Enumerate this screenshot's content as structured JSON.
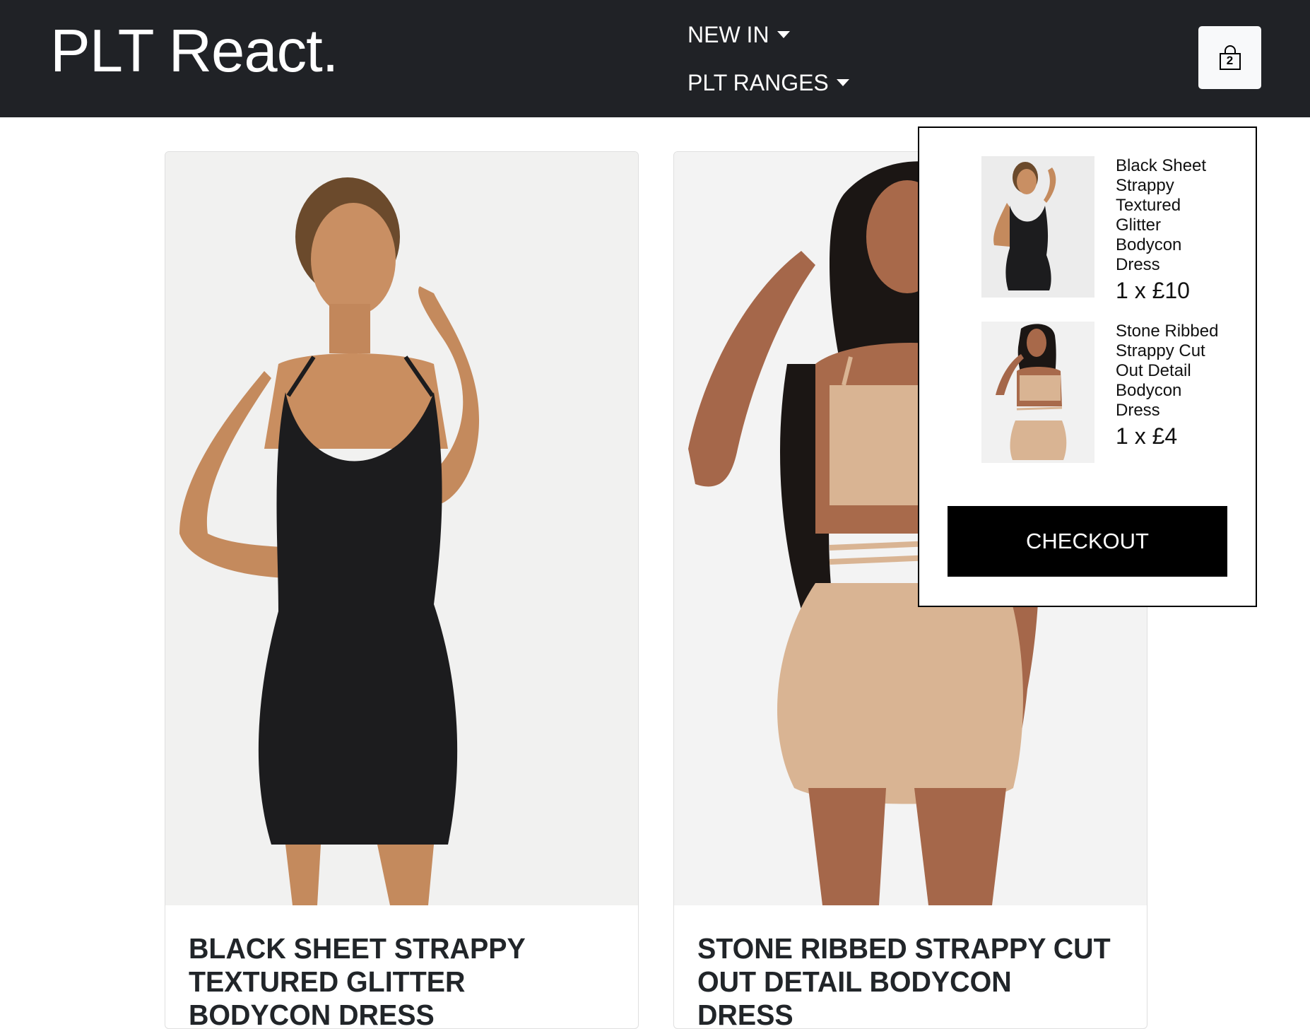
{
  "header": {
    "brand": "PLT React.",
    "nav": [
      {
        "label": "NEW IN"
      },
      {
        "label": "PLT RANGES"
      }
    ],
    "cart_count": "2",
    "icons": {
      "bag": "shopping-bag-icon",
      "caret": "caret-down-icon"
    }
  },
  "products": [
    {
      "title": "BLACK SHEET STRAPPY TEXTURED GLITTER BODYCON DRESS",
      "dress_color": "#1c1c1e"
    },
    {
      "title": "STONE RIBBED STRAPPY CUT OUT DETAIL BODYCON DRESS",
      "dress_color": "#d9b493"
    }
  ],
  "cart": {
    "items": [
      {
        "name": "Black Sheet Strappy Textured Glitter Bodycon Dress",
        "qty_price": "1 x £10"
      },
      {
        "name": "Stone Ribbed Strappy Cut Out Detail Bodycon Dress",
        "qty_price": "1 x £4"
      }
    ],
    "checkout_label": "CHECKOUT"
  },
  "colors": {
    "navbar": "#202226",
    "button": "#000000",
    "photo_background": "#ececec"
  }
}
